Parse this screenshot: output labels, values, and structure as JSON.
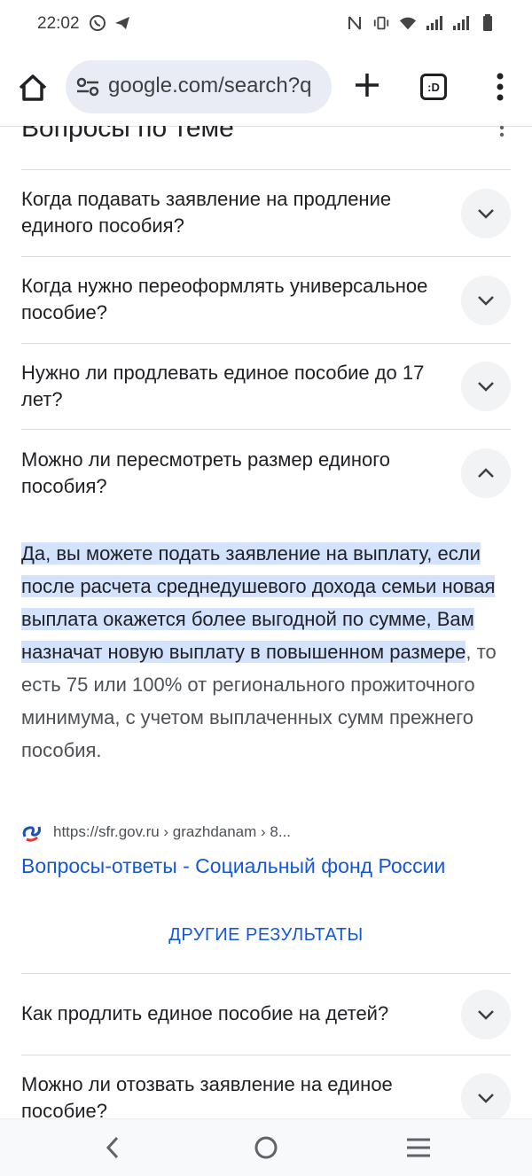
{
  "status_bar": {
    "time": "22:02"
  },
  "toolbar": {
    "url": "google.com/search?q",
    "tabs_count": ":D"
  },
  "section": {
    "title": "Вопросы по теме"
  },
  "questions": [
    {
      "text": "Когда подавать заявление на продление единого пособия?",
      "expanded": false
    },
    {
      "text": "Когда нужно переоформлять универсальное пособие?",
      "expanded": false
    },
    {
      "text": "Нужно ли продлевать единое пособие до 17 лет?",
      "expanded": false
    },
    {
      "text": "Можно ли пересмотреть размер единого пособия?",
      "expanded": true
    }
  ],
  "answer": {
    "highlighted": "Да, вы можете подать заявление на выплату, если после расчета среднедушевого дохода семьи новая выплата окажется более выгодной по сумме, Вам назначат новую выплату в повышенном размере",
    "rest": ", то есть 75 или 100% от регионального прожиточного минимума, с учетом выплаченных сумм прежнего пособия.",
    "source_url": "https://sfr.gov.ru › grazhdanam › 8...",
    "result_title": "Вопросы-ответы - Социальный фонд России"
  },
  "more_results": "ДРУГИЕ РЕЗУЛЬТАТЫ",
  "more_questions": [
    {
      "text": "Как продлить единое пособие на детей?"
    },
    {
      "text": "Можно ли отозвать заявление на единое пособие?"
    }
  ],
  "colors": {
    "accent": "#1558d6",
    "highlight": "#d3e3fd",
    "chevron_bg": "#f1f3f4"
  }
}
